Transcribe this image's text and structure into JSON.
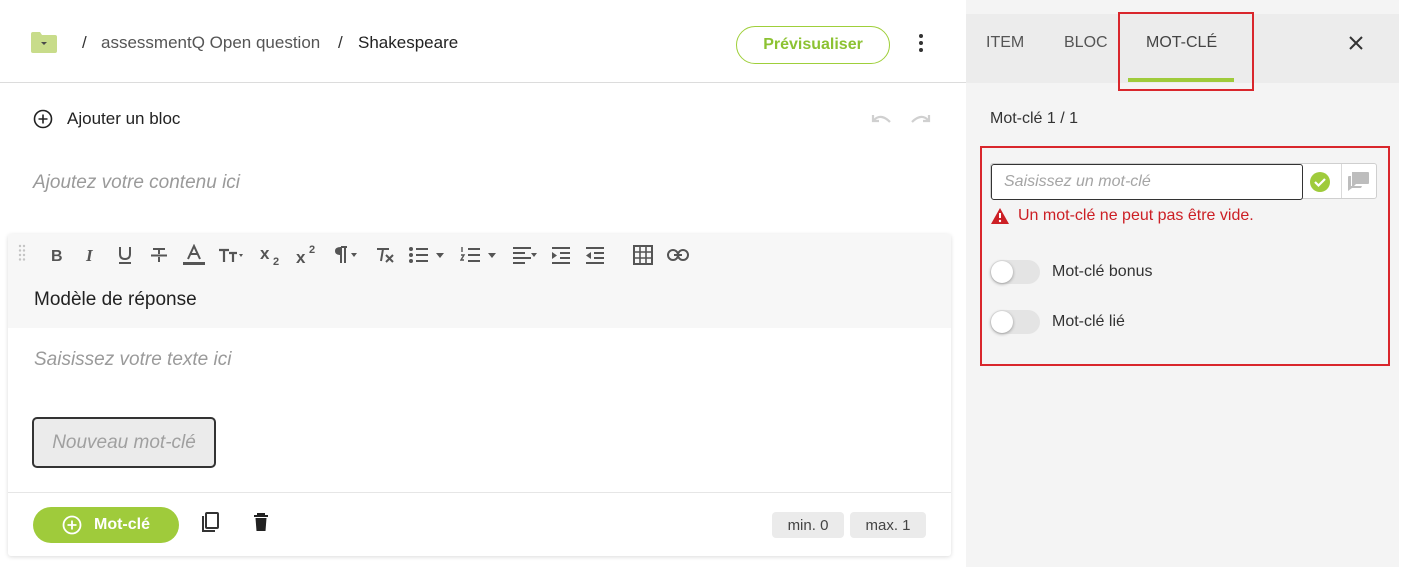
{
  "header": {
    "breadcrumb": [
      {
        "sep": "/",
        "label": "assessmentQ Open question"
      },
      {
        "sep": "/",
        "label": "Shakespeare"
      }
    ],
    "preview_label": "Prévisualiser",
    "folder_color": "#c8dc8a",
    "accent": "#9fcb3b"
  },
  "editor": {
    "add_block_label": "Ajouter un bloc",
    "content_placeholder": "Ajoutez votre contenu ici",
    "block": {
      "title": "Modèle de réponse",
      "text_placeholder": "Saisissez votre texte ici",
      "new_keyword_placeholder": "Nouveau mot-clé",
      "add_keyword_label": "Mot-clé",
      "min_label": "min. 0",
      "max_label": "max. 1"
    },
    "toolbar": [
      "bold-icon",
      "italic-icon",
      "underline-icon",
      "strikethrough-icon",
      "font-color-icon",
      "font-size-icon",
      "subscript-icon",
      "superscript-icon",
      "paragraph-icon",
      "clear-format-icon",
      "bulleted-list-icon",
      "numbered-list-icon",
      "align-icon",
      "indent-icon",
      "outdent-icon",
      "table-icon",
      "link-icon"
    ]
  },
  "panel": {
    "tabs": [
      {
        "label": "ITEM"
      },
      {
        "label": "BLOC"
      },
      {
        "label": "MOT-CLÉ",
        "active": true
      }
    ],
    "keyword_count": "Mot-clé 1 / 1",
    "keyword_input_placeholder": "Saisissez un mot-clé",
    "error_message": "Un mot-clé ne peut pas être vide.",
    "toggles": [
      {
        "label": "Mot-clé bonus",
        "on": false
      },
      {
        "label": "Mot-clé lié",
        "on": false
      }
    ],
    "error_color": "#cc1f25",
    "highlight_color": "#d9262c"
  }
}
